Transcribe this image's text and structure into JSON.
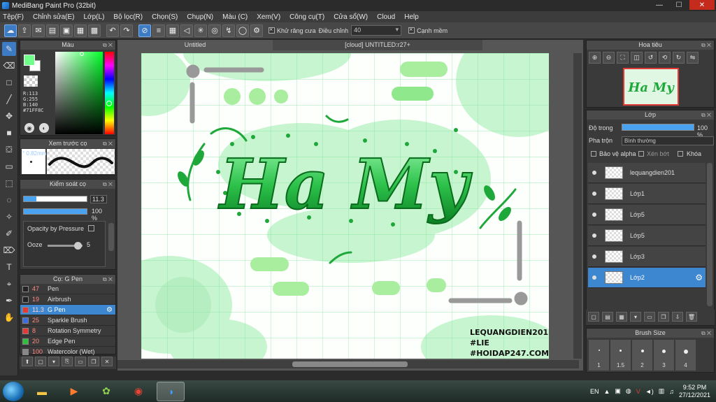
{
  "window": {
    "title": "MediBang Paint Pro (32bit)"
  },
  "menu": [
    "Tệp(F)",
    "Chỉnh sửa(E)",
    "Lớp(L)",
    "Bộ lọc(R)",
    "Chọn(S)",
    "Chụp(N)",
    "Màu (C)",
    "Xem(V)",
    "Công cụ(T)",
    "Cửa sổ(W)",
    "Cloud",
    "Help"
  ],
  "toolbar": {
    "antialias_label": "Khử răng cưa",
    "adjust_label": "Điều chỉnh",
    "adjust_value": "40",
    "snap_label": "Cạnh mềm"
  },
  "color_panel": {
    "title": "Màu",
    "r": "R:113",
    "g": "G:255",
    "b": "B:140",
    "hex": "#71FF8C",
    "fg_color": "#71ff8c"
  },
  "preview_panel": {
    "title": "Xem trước cọ",
    "size": "° 0.82mm"
  },
  "brush_control": {
    "title": "Kiểm soát cọ",
    "size_value": "11.3",
    "size_fraction": 0.2,
    "opacity_value": "100 %",
    "opacity_fraction": 1.0,
    "opacity_pressure_label": "Opacity by Pressure",
    "ooze_label": "Ooze",
    "ooze_value": "5"
  },
  "brush_list": {
    "title": "Cọ: G Pen",
    "items": [
      {
        "size": "47",
        "name": "Pen",
        "color": "#222222"
      },
      {
        "size": "19",
        "name": "Airbrush",
        "color": "#222222"
      },
      {
        "size": "11.3",
        "name": "G Pen",
        "color": "#e53935",
        "selected": true
      },
      {
        "size": "25",
        "name": "Sparkle Brush",
        "color": "#3d6ce0"
      },
      {
        "size": "8",
        "name": "Rotation Symmetry",
        "color": "#e53935"
      },
      {
        "size": "20",
        "name": "Edge Pen",
        "color": "#2fbf3a"
      },
      {
        "size": "100",
        "name": "Watercolor (Wet)",
        "color": "#888888"
      }
    ]
  },
  "canvas": {
    "tab1": "Untitled",
    "tab2": "[cloud] UNTITLED:r27+",
    "art_title": "Ha My",
    "watermark1": "LEQUANGDIEN201",
    "watermark2": "#LIE",
    "watermark3": "#HOIDAP247.COM"
  },
  "navigator": {
    "title": "Hoa tiêu",
    "thumb_text": "Ha My"
  },
  "layer_panel": {
    "title": "Lớp",
    "opacity_label": "Độ trong",
    "opacity_value": "100 %",
    "blend_label": "Pha trộn",
    "blend_value": "Bình thường",
    "protect_alpha": "Bảo vệ alpha",
    "clipping": "Xén bớt",
    "lock": "Khóa",
    "layers": [
      {
        "name": "lequangdien201"
      },
      {
        "name": "Lớp1"
      },
      {
        "name": "Lớp5"
      },
      {
        "name": "Lớp5"
      },
      {
        "name": "Lớp3"
      },
      {
        "name": "Lớp2",
        "selected": true
      }
    ]
  },
  "brush_size_panel": {
    "title": "Brush Size",
    "sizes": [
      "1",
      "1.5",
      "2",
      "3",
      "4"
    ]
  },
  "taskbar": {
    "lang": "EN",
    "time": "9:52 PM",
    "date": "27/12/2021"
  }
}
